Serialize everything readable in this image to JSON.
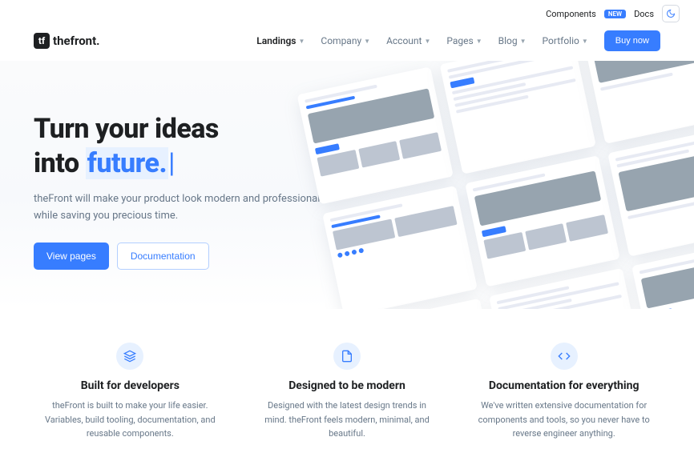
{
  "topbar": {
    "components": "Components",
    "new_badge": "NEW",
    "docs": "Docs"
  },
  "logo": {
    "mark": "tf",
    "text": "thefront."
  },
  "nav": {
    "items": [
      {
        "label": "Landings",
        "active": true
      },
      {
        "label": "Company",
        "active": false
      },
      {
        "label": "Account",
        "active": false
      },
      {
        "label": "Pages",
        "active": false
      },
      {
        "label": "Blog",
        "active": false
      },
      {
        "label": "Portfolio",
        "active": false
      }
    ],
    "buy": "Buy now"
  },
  "hero": {
    "title_line1": "Turn your ideas",
    "title_line2_prefix": "into ",
    "title_typed": "future.",
    "subtitle": "theFront will make your product look modern and professional while saving you precious time.",
    "btn_primary": "View pages",
    "btn_secondary": "Documentation"
  },
  "features": [
    {
      "title": "Built for developers",
      "desc": "theFront is built to make your life easier. Variables, build tooling, documentation, and reusable components."
    },
    {
      "title": "Designed to be modern",
      "desc": "Designed with the latest design trends in mind. theFront feels modern, minimal, and beautiful."
    },
    {
      "title": "Documentation for everything",
      "desc": "We've written extensive documentation for components and tools, so you never have to reverse engineer anything."
    }
  ]
}
